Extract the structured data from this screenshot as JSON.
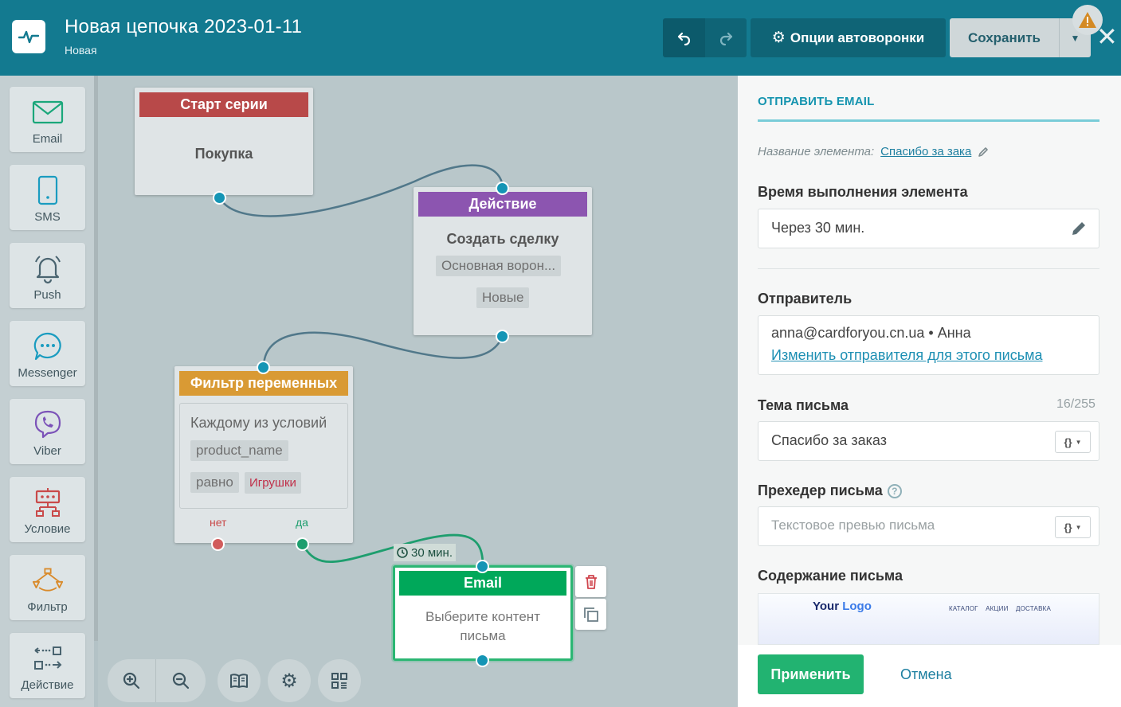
{
  "header": {
    "title": "Новая цепочка 2023-01-11",
    "subtitle": "Новая",
    "options_label": "Опции автоворонки",
    "save_label": "Сохранить"
  },
  "toolbar": {
    "items": [
      {
        "label": "Email",
        "icon": "envelope-icon"
      },
      {
        "label": "SMS",
        "icon": "phone-icon"
      },
      {
        "label": "Push",
        "icon": "bell-icon"
      },
      {
        "label": "Messenger",
        "icon": "chat-bubble-icon"
      },
      {
        "label": "Viber",
        "icon": "viber-icon"
      },
      {
        "label": "Условие",
        "icon": "condition-icon"
      },
      {
        "label": "Фильтр",
        "icon": "filter-icon"
      },
      {
        "label": "Действие",
        "icon": "action-icon"
      }
    ]
  },
  "canvas": {
    "start_node": {
      "header": "Старт серии",
      "text": "Покупка"
    },
    "action_node": {
      "header": "Действие",
      "text": "Создать сделку",
      "chip1": "Основная ворон...",
      "chip2": "Новые"
    },
    "filter_node": {
      "header": "Фильтр переменных",
      "condition": "Каждому из условий",
      "field": "product_name",
      "operator": "равно",
      "value": "Игрушки",
      "no_label": "нет",
      "yes_label": "да"
    },
    "delay_label": "30 мин.",
    "email_node": {
      "header": "Email",
      "text": "Выберите контент письма"
    }
  },
  "colors": {
    "header_bg": "#137a90",
    "start": "#b84949",
    "action": "#8c55b0",
    "filter": "#d99a34",
    "email": "#00a85a",
    "apply": "#22b371"
  },
  "panel": {
    "heading": "ОТПРАВИТЬ EMAIL",
    "name_label": "Название элемента:",
    "name_value": "Спасибо за зака",
    "time_label": "Время выполнения элемента",
    "time_value": "Через 30 мин.",
    "sender_label": "Отправитель",
    "sender_value": "anna@cardforyou.cn.ua • Анна",
    "sender_change": "Изменить отправителя для этого письма",
    "subject_label": "Тема письма",
    "subject_counter": "16/255",
    "subject_value": "Спасибо за заказ",
    "preheader_label": "Прехедер письма",
    "preheader_placeholder": "Текстовое превью письма",
    "content_label": "Содержание письма",
    "preview_logo_a": "Your ",
    "preview_logo_b": "Logo",
    "preview_nav": "КАТАЛОГ АКЦИИ ДОСТАВКА",
    "apply_label": "Применить",
    "cancel_label": "Отмена"
  }
}
